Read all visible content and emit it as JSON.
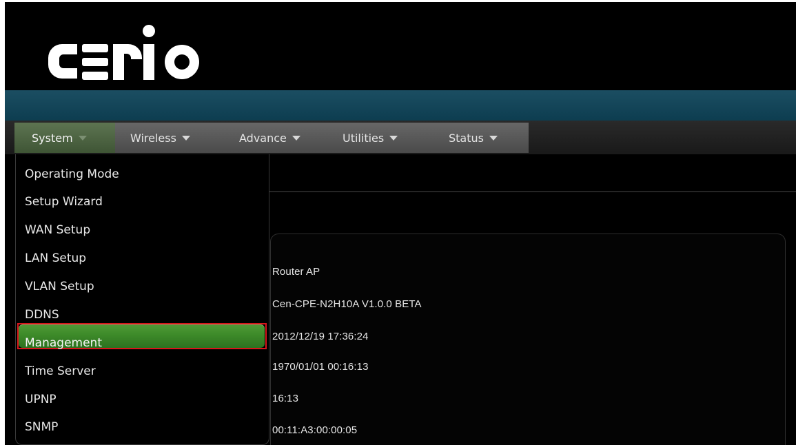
{
  "brand": {
    "logo_text": "CERIO",
    "accent": "#4f9a37",
    "highlight_border": "#d8161c"
  },
  "menu": {
    "items": [
      {
        "label": "System",
        "active": true
      },
      {
        "label": "Wireless",
        "active": false
      },
      {
        "label": "Advance",
        "active": false
      },
      {
        "label": "Utilities",
        "active": false
      },
      {
        "label": "Status",
        "active": false
      }
    ],
    "caret_icon": "triangle-down-icon"
  },
  "system_dropdown": {
    "items": [
      "Operating Mode",
      "Setup Wizard",
      "WAN Setup",
      "LAN Setup",
      "VLAN Setup",
      "DDNS",
      "Management",
      "Time Server",
      "UPNP",
      "SNMP"
    ],
    "selected": "Management"
  },
  "system_info": {
    "values": [
      "Router AP",
      "Cen-CPE-N2H10A V1.0.0 BETA",
      "2012/12/19 17:36:24",
      "1970/01/01 00:16:13",
      "16:13",
      "00:11:A3:00:00:05"
    ]
  }
}
